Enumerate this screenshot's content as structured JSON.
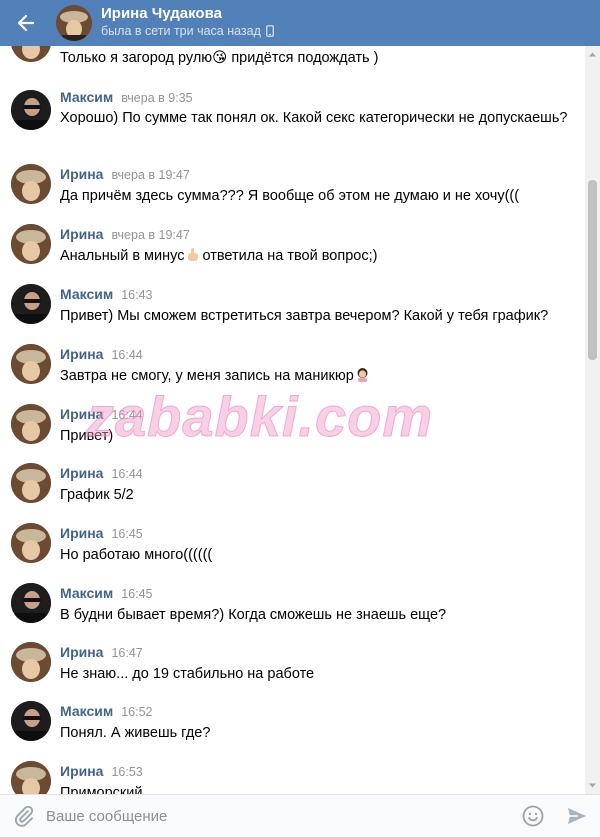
{
  "header": {
    "back_icon": "arrow-left-icon",
    "name": "Ирина Чудакова",
    "status": "была в сети три часа назад",
    "status_icon": "mobile-phone-icon"
  },
  "messages": [
    {
      "text": "Только я загород рулю😘 придётся подождать )"
    },
    {
      "author": "Максим",
      "time": "вчера в 9:35",
      "text": "Хорошо) По сумме так понял ок. Какой секс категорически не допускаешь?"
    },
    {
      "author": "Ирина",
      "time": "вчера в 19:47",
      "text": "Да причём здесь сумма??? Я вообще об этом не думаю и не хочу((("
    },
    {
      "author": "Ирина",
      "time": "вчера в 19:47",
      "text_before": "Анальный в минус",
      "text_after": "ответила на твой вопрос;)"
    },
    {
      "author": "Максим",
      "time": "16:43",
      "text": "Привет) Мы сможем встретиться завтра вечером? Какой у тебя график?"
    },
    {
      "author": "Ирина",
      "time": "16:44",
      "text": "Завтра не смогу, у меня запись на маникюр"
    },
    {
      "author": "Ирина",
      "time": "16:44",
      "text": "Привет)"
    },
    {
      "author": "Ирина",
      "time": "16:44",
      "text": "График 5/2"
    },
    {
      "author": "Ирина",
      "time": "16:45",
      "text": "Но работаю много(((((("
    },
    {
      "author": "Максим",
      "time": "16:45",
      "text": "В будни бывает время?) Когда сможешь не знаешь еще?"
    },
    {
      "author": "Ирина",
      "time": "16:47",
      "text": "Не знаю... до 19 стабильно на работе"
    },
    {
      "author": "Максим",
      "time": "16:52",
      "text": "Понял. А живешь где?"
    },
    {
      "author": "Ирина",
      "time": "16:53",
      "text": "Приморский"
    }
  ],
  "watermark": "zababki.com",
  "composer": {
    "placeholder": "Ваше сообщение",
    "attach_icon": "paperclip-icon",
    "emoji_icon": "smile-icon",
    "send_icon": "send-icon"
  },
  "colors": {
    "header_bg": "#5181b8",
    "author_name": "#42648b",
    "timestamp": "#939393"
  }
}
